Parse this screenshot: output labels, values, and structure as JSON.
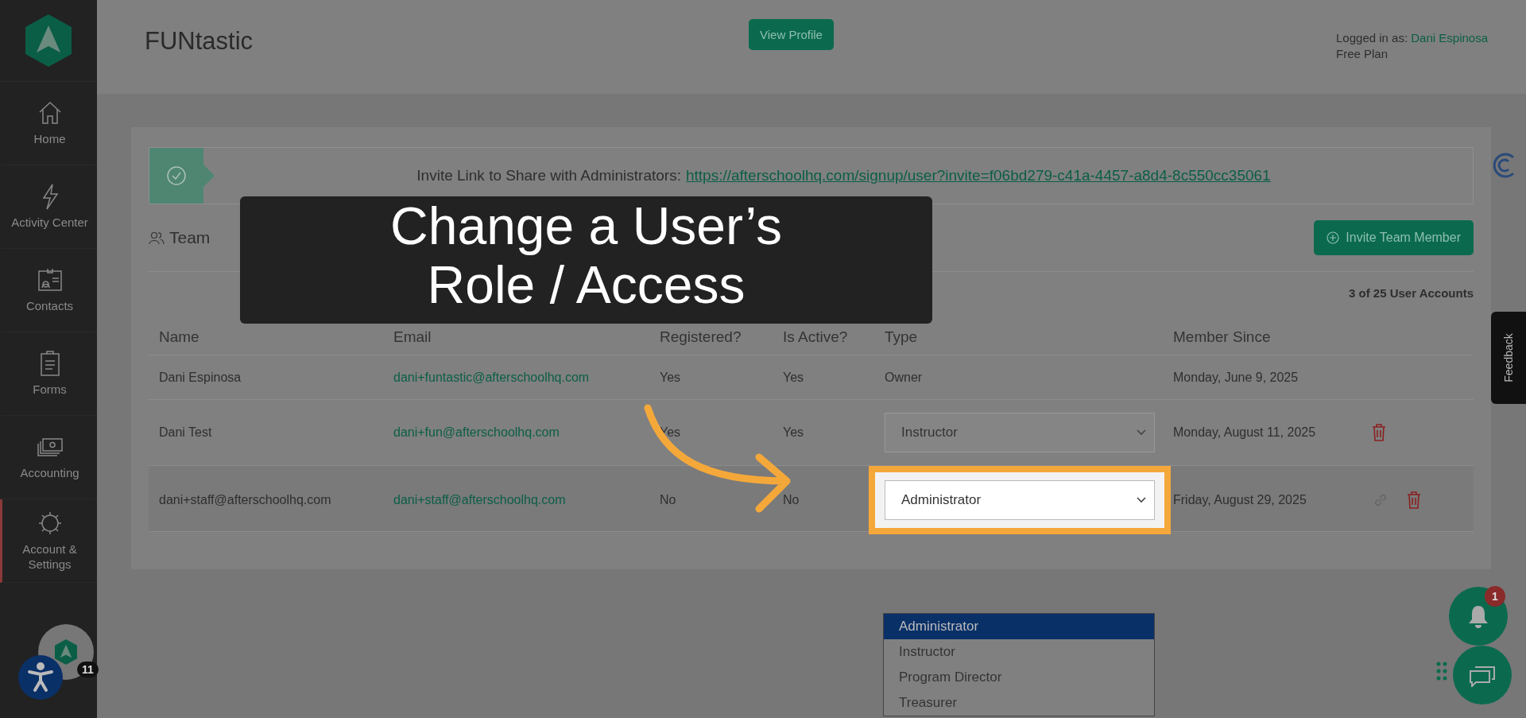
{
  "sidebar": {
    "items": [
      {
        "label": "Home",
        "selected": false
      },
      {
        "label": "Activity Center",
        "selected": false
      },
      {
        "label": "Contacts",
        "selected": false
      },
      {
        "label": "Forms",
        "selected": false
      },
      {
        "label": "Accounting",
        "selected": false
      },
      {
        "label": "Account & Settings",
        "selected": true
      }
    ],
    "avatar_badge": "11"
  },
  "header": {
    "title": "FUNtastic",
    "view_profile": "View Profile",
    "logged_in_label": "Logged in as:",
    "user": "Dani Espinosa",
    "plan": "Free Plan"
  },
  "invite": {
    "label": "Invite Link to Share with Administrators:",
    "link": "https://afterschoolhq.com/signup/user?invite=f06bd279-c41a-4457-a8d4-8c550cc35061"
  },
  "team": {
    "title": "Team",
    "invite_button": "Invite Team Member",
    "count": "3 of 25 User Accounts"
  },
  "table": {
    "columns": [
      "Name",
      "Email",
      "Registered?",
      "Is Active?",
      "Type",
      "Member Since"
    ],
    "rows": [
      {
        "name": "Dani Espinosa",
        "email": "dani+funtastic@afterschoolhq.com",
        "registered": "Yes",
        "active": "Yes",
        "kind": "text",
        "type": "Owner",
        "since": "Monday, June 9, 2025",
        "link_action": false,
        "delete_action": false,
        "highlighted": false
      },
      {
        "name": "Dani Test",
        "email": "dani+fun@afterschoolhq.com",
        "registered": "Yes",
        "active": "Yes",
        "kind": "select",
        "type": "Instructor",
        "since": "Monday, August 11, 2025",
        "link_action": false,
        "delete_action": true,
        "highlighted": false
      },
      {
        "name": "dani+staff@afterschoolhq.com",
        "email": "dani+staff@afterschoolhq.com",
        "registered": "No",
        "active": "No",
        "kind": "select",
        "type": "Administrator",
        "since": "Friday, August 29, 2025",
        "link_action": true,
        "delete_action": true,
        "highlighted": true
      }
    ]
  },
  "dropdown": {
    "options": [
      {
        "label": "Administrator",
        "selected": true
      },
      {
        "label": "Instructor",
        "selected": false
      },
      {
        "label": "Program Director",
        "selected": false
      },
      {
        "label": "Treasurer",
        "selected": false
      }
    ]
  },
  "overlay": {
    "title": "Change a User’s Role / Access"
  },
  "feedback": "Feedback",
  "notifications": {
    "badge": "1"
  }
}
